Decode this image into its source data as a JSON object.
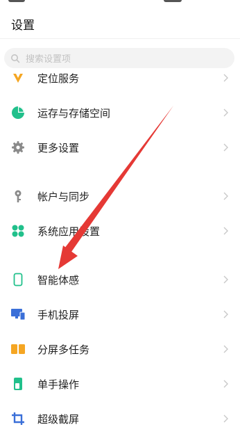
{
  "header": {
    "title": "设置"
  },
  "search": {
    "placeholder": "搜索设置项"
  },
  "items": [
    {
      "label": "定位服务",
      "icon": "location-icon",
      "color": "#f5a623"
    },
    {
      "label": "运存与存储空间",
      "icon": "pie-chart-icon",
      "color": "#21c08b"
    },
    {
      "label": "更多设置",
      "icon": "gear-icon",
      "color": "#8a8a8a"
    },
    {
      "label": "帐户与同步",
      "icon": "key-icon",
      "color": "#8a8a8a"
    },
    {
      "label": "系统应用设置",
      "icon": "apps-icon",
      "color": "#21c08b"
    },
    {
      "label": "智能体感",
      "icon": "phone-outline-icon",
      "color": "#21c08b"
    },
    {
      "label": "手机投屏",
      "icon": "screen-cast-icon",
      "color": "#3a6fd8"
    },
    {
      "label": "分屏多任务",
      "icon": "split-screen-icon",
      "color": "#f5a623"
    },
    {
      "label": "单手操作",
      "icon": "one-hand-icon",
      "color": "#21c08b"
    },
    {
      "label": "超级截屏",
      "icon": "crop-icon",
      "color": "#3a6fd8"
    }
  ],
  "annotation": {
    "arrow_color": "#e53935"
  }
}
